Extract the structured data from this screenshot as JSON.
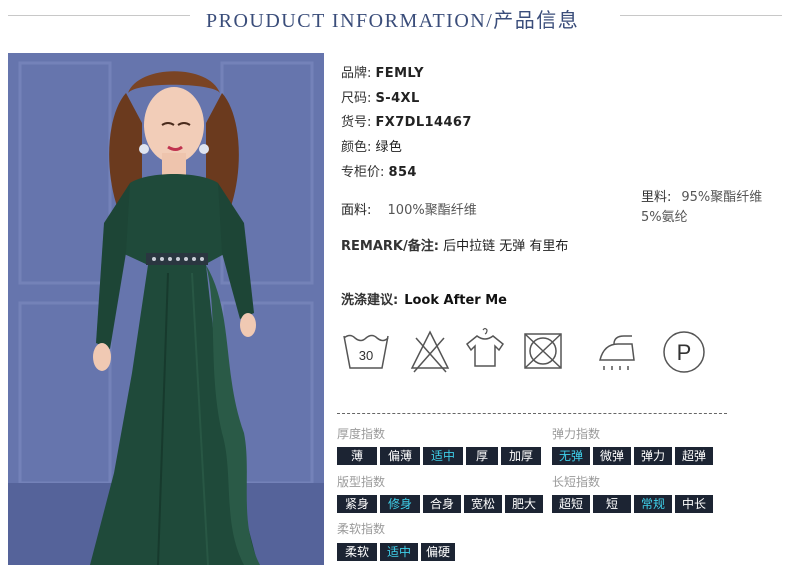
{
  "header": {
    "title": "PROUDUCT INFORMATION/产品信息"
  },
  "info": {
    "brand": {
      "key": "品牌:",
      "value": "FEMLY"
    },
    "size": {
      "key": "尺码:",
      "value": "S-4XL"
    },
    "sku": {
      "key": "货号:",
      "value": "FX7DL14467"
    },
    "color": {
      "key": "颜色:",
      "value": "绿色"
    },
    "price": {
      "key": "专柜价:",
      "value": "854"
    },
    "fabric": {
      "key": "面料:",
      "value": "100%聚酯纤维"
    },
    "lining": {
      "key": "里料:",
      "value_line1": "95%聚酯纤维",
      "value_line2": "5%氨纶"
    },
    "remark": {
      "key": "REMARK/备注:",
      "value": "后中拉链 无弹 有里布"
    },
    "wash": {
      "key": "洗涤建议:",
      "value": "Look After Me"
    }
  },
  "care_icons": [
    {
      "name": "wash-30-icon",
      "label": "30"
    },
    {
      "name": "no-bleach-icon"
    },
    {
      "name": "hang-dry-icon"
    },
    {
      "name": "no-tumble-dry-icon"
    },
    {
      "name": "iron-icon"
    },
    {
      "name": "dry-clean-p-icon",
      "label": "P"
    }
  ],
  "indices": {
    "thickness": {
      "label": "厚度指数",
      "options": [
        "薄",
        "偏薄",
        "适中",
        "厚",
        "加厚"
      ],
      "selected": 2
    },
    "elasticity": {
      "label": "弹力指数",
      "options": [
        "无弹",
        "微弹",
        "弹力",
        "超弹"
      ],
      "selected": 0
    },
    "fit": {
      "label": "版型指数",
      "options": [
        "紧身",
        "修身",
        "合身",
        "宽松",
        "肥大"
      ],
      "selected": 1
    },
    "length": {
      "label": "长短指数",
      "options": [
        "超短",
        "短",
        "常规",
        "中长"
      ],
      "selected": 2
    },
    "softness": {
      "label": "柔软指数",
      "options": [
        "柔软",
        "适中",
        "偏硬"
      ],
      "selected": 1
    }
  },
  "colors": {
    "title": "#3a4d7a",
    "option_bg": "#1c2433",
    "option_selected_text": "#3fd0ea",
    "dress": "#1f4a3a",
    "backdrop": "#6574ad"
  }
}
